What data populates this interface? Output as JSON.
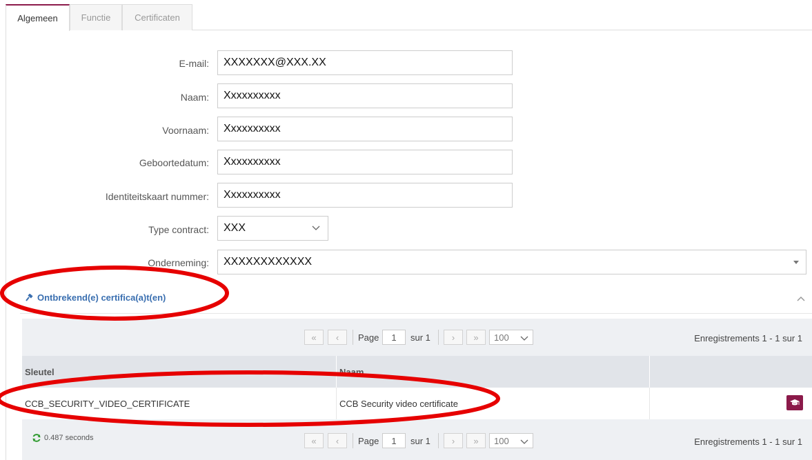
{
  "tabs": [
    {
      "label": "Algemeen",
      "active": true
    },
    {
      "label": "Functie",
      "active": false
    },
    {
      "label": "Certificaten",
      "active": false
    }
  ],
  "form": {
    "email": {
      "label": "E-mail:",
      "value": "XXXXXXX@XXX.XX"
    },
    "naam": {
      "label": "Naam:",
      "value": "Xxxxxxxxxx"
    },
    "voornaam": {
      "label": "Voornaam:",
      "value": "Xxxxxxxxxx"
    },
    "geboortedatum": {
      "label": "Geboortedatum:",
      "value": "Xxxxxxxxxx"
    },
    "identiteitskaart": {
      "label": "Identiteitskaart nummer:",
      "value": "Xxxxxxxxxx"
    },
    "type_contract": {
      "label": "Type contract:",
      "value": "XXX"
    },
    "onderneming": {
      "label": "Onderneming:",
      "value": "XXXXXXXXXXXX"
    }
  },
  "missing": {
    "title": "Ontbrekend(e) certifica(a)t(en)"
  },
  "pager": {
    "page_label": "Page",
    "page_value": "1",
    "of_label": "sur 1",
    "page_size": "100",
    "records": "Enregistrements 1 - 1 sur 1",
    "first": "«",
    "prev": "‹",
    "next": "›",
    "last": "»"
  },
  "grid": {
    "columns": [
      "Sleutel",
      "Naam",
      ""
    ],
    "rows": [
      [
        "CCB_SECURITY_VIDEO_CERTIFICATE",
        "CCB Security video certificate"
      ]
    ]
  },
  "timing": "0.487 seconds",
  "colors": {
    "accent": "#8b1a4a",
    "link": "#3a6fb0",
    "annotation": "#e60000"
  }
}
